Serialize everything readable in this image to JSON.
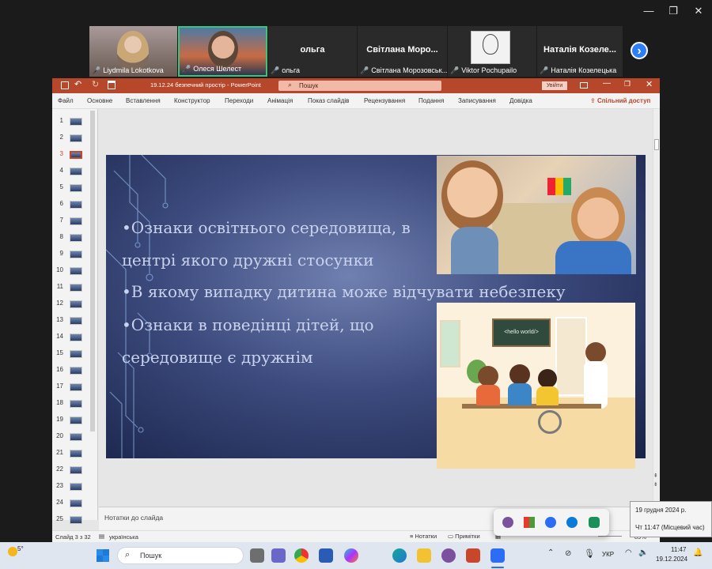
{
  "window_controls": {
    "minimize": "—",
    "restore": "❐",
    "close": "✕"
  },
  "participants": [
    {
      "name": "Liydmila Lokotkova",
      "has_video": true
    },
    {
      "name": "Олеся Шелест",
      "has_video": true,
      "active": true
    },
    {
      "name": "ольга",
      "display": "ольга",
      "has_video": false
    },
    {
      "name": "Світлана Морозовськ...",
      "display": "Світлана  Моро...",
      "has_video": false
    },
    {
      "name": "Viktor Pochupailo",
      "has_video": true
    },
    {
      "name": "Наталія Козелецька",
      "display": "Наталія  Козеле...",
      "has_video": false
    }
  ],
  "next_icon": "›",
  "powerpoint": {
    "title": "19.12.24 безпечний простір  -  PowerPoint",
    "search_placeholder": "Пошук",
    "signin": "Увійти",
    "menu": [
      "Файл",
      "Основне",
      "Вставлення",
      "Конструктор",
      "Переходи",
      "Анімація",
      "Показ слайдів",
      "Рецензування",
      "Подання",
      "Записування",
      "Довідка"
    ],
    "share": "Спільний доступ",
    "slide_numbers": [
      "1",
      "2",
      "3",
      "4",
      "5",
      "6",
      "7",
      "8",
      "9",
      "10",
      "11",
      "12",
      "13",
      "14",
      "15",
      "16",
      "17",
      "18",
      "19",
      "20",
      "21",
      "22",
      "23",
      "24",
      "25"
    ],
    "selected_slide": "3",
    "slide": {
      "lines": [
        "•Ознаки освітнього середовища, в",
        "центрі якого дружні стосунки",
        "•В якому випадку дитина може відчувати небезпеку",
        "•Ознаки в поведінці дітей, що",
        "середовище є дружнім"
      ],
      "board_text": "<hello world/>"
    },
    "notes_placeholder": "Нотатки до слайда",
    "status": {
      "slide": "Слайд 3 з 32",
      "lang": "українська",
      "notes": "Нотатки",
      "comments": "Примітки",
      "zoom": "89%"
    }
  },
  "tooltip": {
    "date": "19 грудня 2024 р.",
    "time": "Чт 11:47 (Місцевий час)"
  },
  "taskbar": {
    "weather": "5°",
    "search": "Пошук",
    "lang": "УКР",
    "time": "11:47",
    "date": "19.12.2024"
  }
}
